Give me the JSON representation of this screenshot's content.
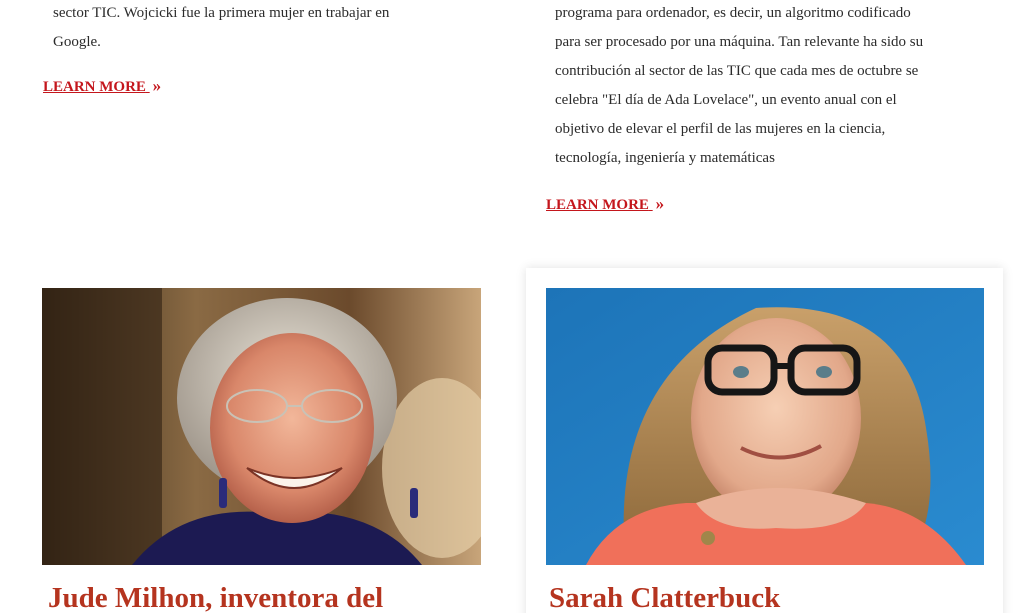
{
  "cards": [
    {
      "excerpt_lines": [
        "sector TIC. Wojcicki fue la primera mujer en trabajar en",
        "Google."
      ],
      "learn_more": "LEARN MORE",
      "chevron": "»"
    },
    {
      "excerpt_lines": [
        "programa para ordenador, es decir, un algoritmo codificado",
        "para ser procesado por una máquina. Tan relevante ha sido su",
        "contribución al sector de las TIC que cada mes de octubre se",
        "celebra \"El día de Ada Lovelace\", un evento anual con el",
        "objetivo de elevar el perfil de las mujeres en la ciencia,",
        "tecnología, ingeniería y matemáticas"
      ],
      "learn_more": "LEARN MORE",
      "chevron": "»"
    }
  ],
  "featured": [
    {
      "title": "Jude Milhon, inventora del"
    },
    {
      "title": "Sarah Clatterbuck"
    }
  ],
  "colors": {
    "accent_red": "#c4161c",
    "title_red": "#b5341f",
    "photo_blue": "#1f7fc0"
  }
}
